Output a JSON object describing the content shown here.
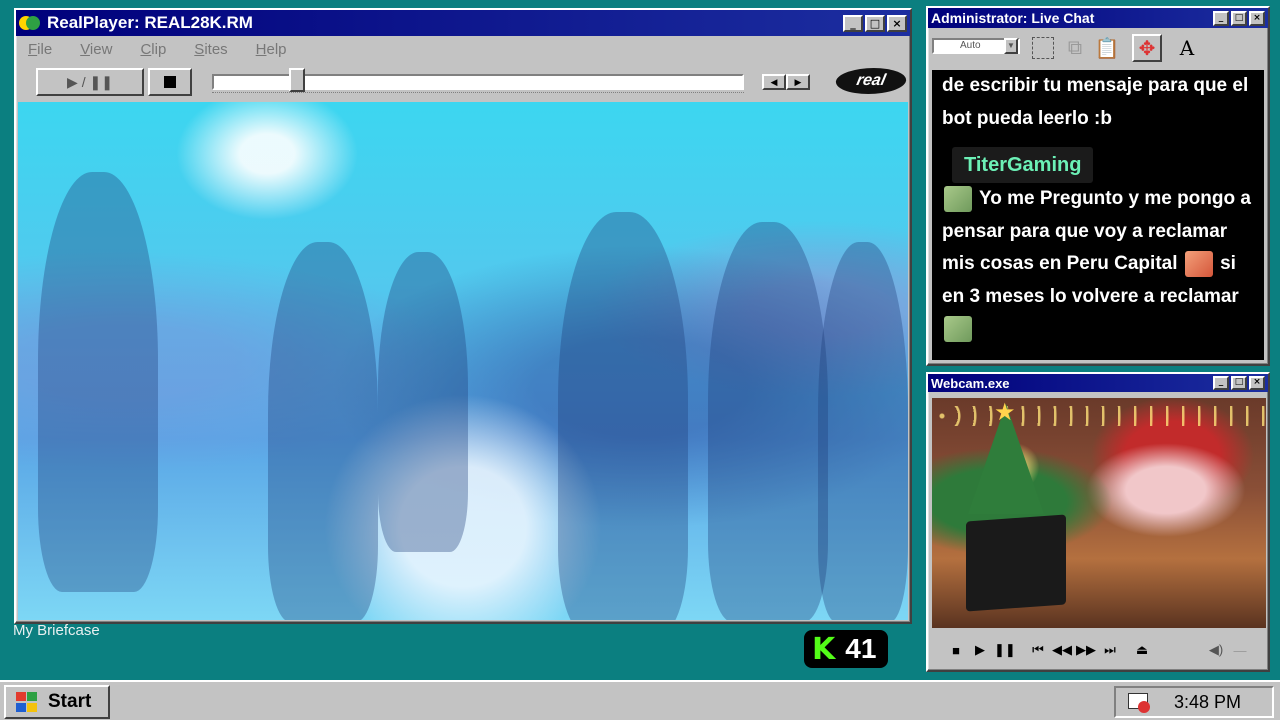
{
  "realplayer": {
    "title": "RealPlayer: REAL28K.RM",
    "menu": [
      "File",
      "View",
      "Clip",
      "Sites",
      "Help"
    ],
    "play_pause_label": "▶ / ❚❚",
    "logo_text": "real",
    "seek_position": 0.15
  },
  "chat": {
    "title": "Administrator: Live Chat",
    "font_select": "Auto",
    "messages": {
      "first_text": "de escribir tu mensaje para que el bot pueda leerlo :b",
      "username": "TiterGaming",
      "second_part1": "Yo me Pregunto y me pongo a pensar para que voy a reclamar mis cosas en Peru Capital",
      "second_part2": "si en 3 meses lo volvere a reclamar"
    },
    "username_color": "#6cf0b6"
  },
  "webcam": {
    "title": "Webcam.exe"
  },
  "desktop": {
    "briefcase_label": "My Briefcase"
  },
  "kick": {
    "logo": "K",
    "viewer_count": "41",
    "accent": "#53fc18"
  },
  "taskbar": {
    "start_label": "Start",
    "clock": "3:48 PM"
  }
}
